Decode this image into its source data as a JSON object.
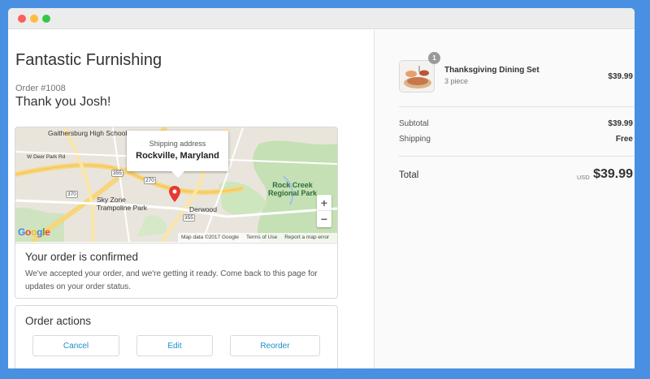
{
  "window": {
    "colors": {
      "close": "#fc605c",
      "minimize": "#fdbc40",
      "maximize": "#34c84a"
    }
  },
  "shop": {
    "name": "Fantastic Furnishing"
  },
  "order": {
    "number": "Order #1008",
    "thank_you": "Thank you Josh!"
  },
  "map": {
    "tooltip_label": "Shipping address",
    "tooltip_value": "Rockville, Maryland",
    "places": [
      "Gaithersburg High School",
      "W Deer Park Rd",
      "Sky Zone Trampoline Park",
      "Derwood",
      "Rock Creek Regional Park"
    ],
    "highway_shields": [
      "270",
      "370",
      "355",
      "355"
    ],
    "zoom_in": "+",
    "zoom_out": "−",
    "logo": "Google",
    "footer": {
      "map_data": "Map data ©2017 Google",
      "terms": "Terms of Use",
      "report": "Report a map error"
    },
    "pin_color": "#e53935"
  },
  "confirmation": {
    "title": "Your order is confirmed",
    "text": "We've accepted your order, and we're getting it ready. Come back to this page for updates on your order status."
  },
  "actions": {
    "title": "Order actions",
    "cancel": "Cancel",
    "edit": "Edit",
    "reorder": "Reorder",
    "link_color": "#1990c6"
  },
  "summary": {
    "item": {
      "name": "Thanksgiving Dining Set",
      "variant": "3 piece",
      "price": "$39.99",
      "quantity": "1"
    },
    "subtotal_label": "Subtotal",
    "subtotal_value": "$39.99",
    "shipping_label": "Shipping",
    "shipping_value": "Free",
    "total_label": "Total",
    "currency": "USD",
    "total_value": "$39.99"
  }
}
